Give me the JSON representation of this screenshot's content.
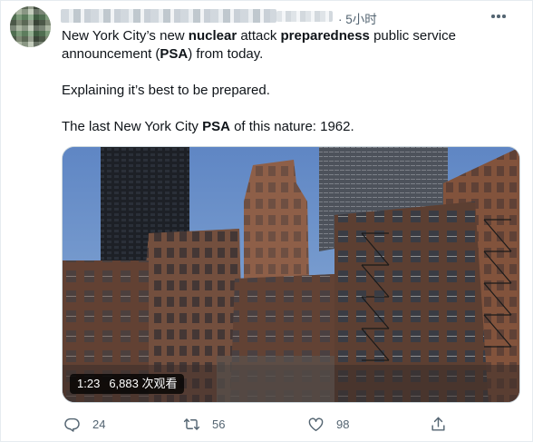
{
  "tweet": {
    "time": "· 5小时",
    "body": {
      "line1_pre": "New York City’s new ",
      "line1_b1": "nuclear",
      "line1_mid": " attack ",
      "line1_b2": "preparedness",
      "line1_post": " public service",
      "line2_pre": "announcement (",
      "line2_b": "PSA",
      "line2_post": ") from today.",
      "para2": "Explaining it’s best to be prepared.",
      "para3_pre": "The last New York City ",
      "para3_b": "PSA",
      "para3_post": " of this nature: 1962."
    },
    "video": {
      "duration": "1:23",
      "views": "6,883 次观看"
    },
    "actions": {
      "reply_count": "24",
      "retweet_count": "56",
      "like_count": "98"
    }
  },
  "colors": {
    "text": "#0f1419",
    "secondary": "#536471",
    "border": "#e6ecf0"
  },
  "icons": [
    "more-icon",
    "reply-icon",
    "retweet-icon",
    "like-icon",
    "share-icon"
  ]
}
